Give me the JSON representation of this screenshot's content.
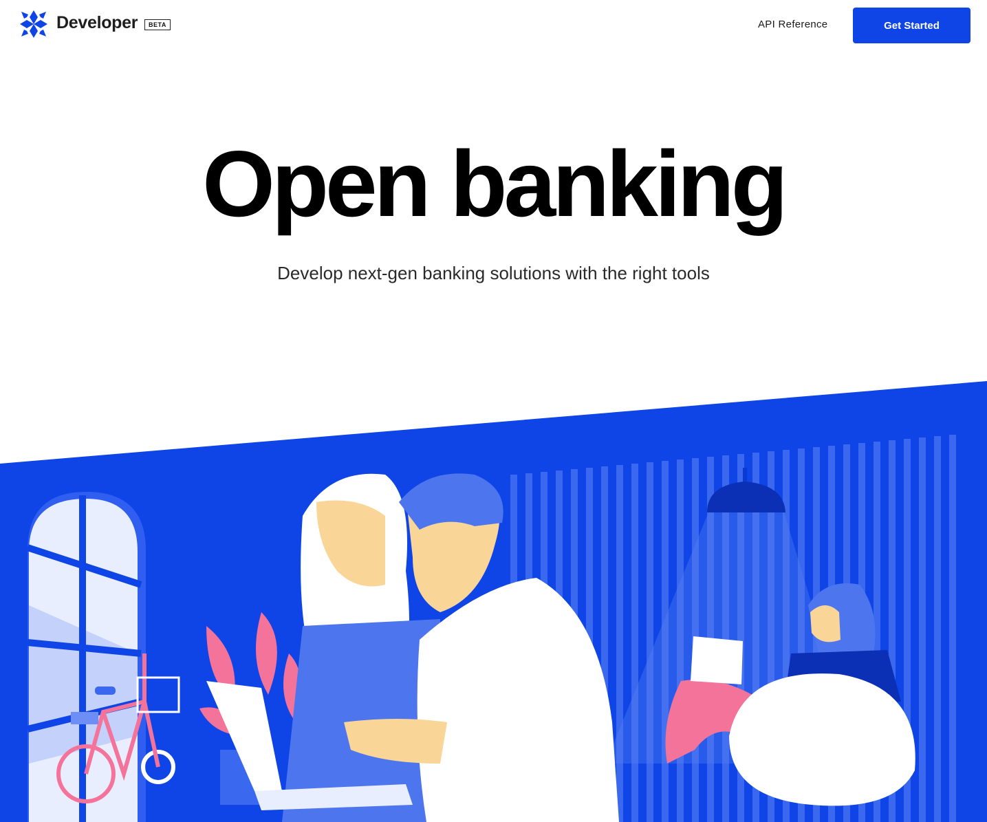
{
  "header": {
    "brand": "Developer",
    "badge": "BETA",
    "nav_link": "API Reference",
    "cta_label": "Get Started"
  },
  "hero": {
    "title": "Open banking",
    "subtitle": "Develop next-gen banking solutions with the right tools"
  },
  "colors": {
    "brand_blue": "#0f45e6",
    "accent_pink": "#f4739a",
    "skin": "#f9d597"
  },
  "icons": [
    "star-grid-logo-icon"
  ]
}
